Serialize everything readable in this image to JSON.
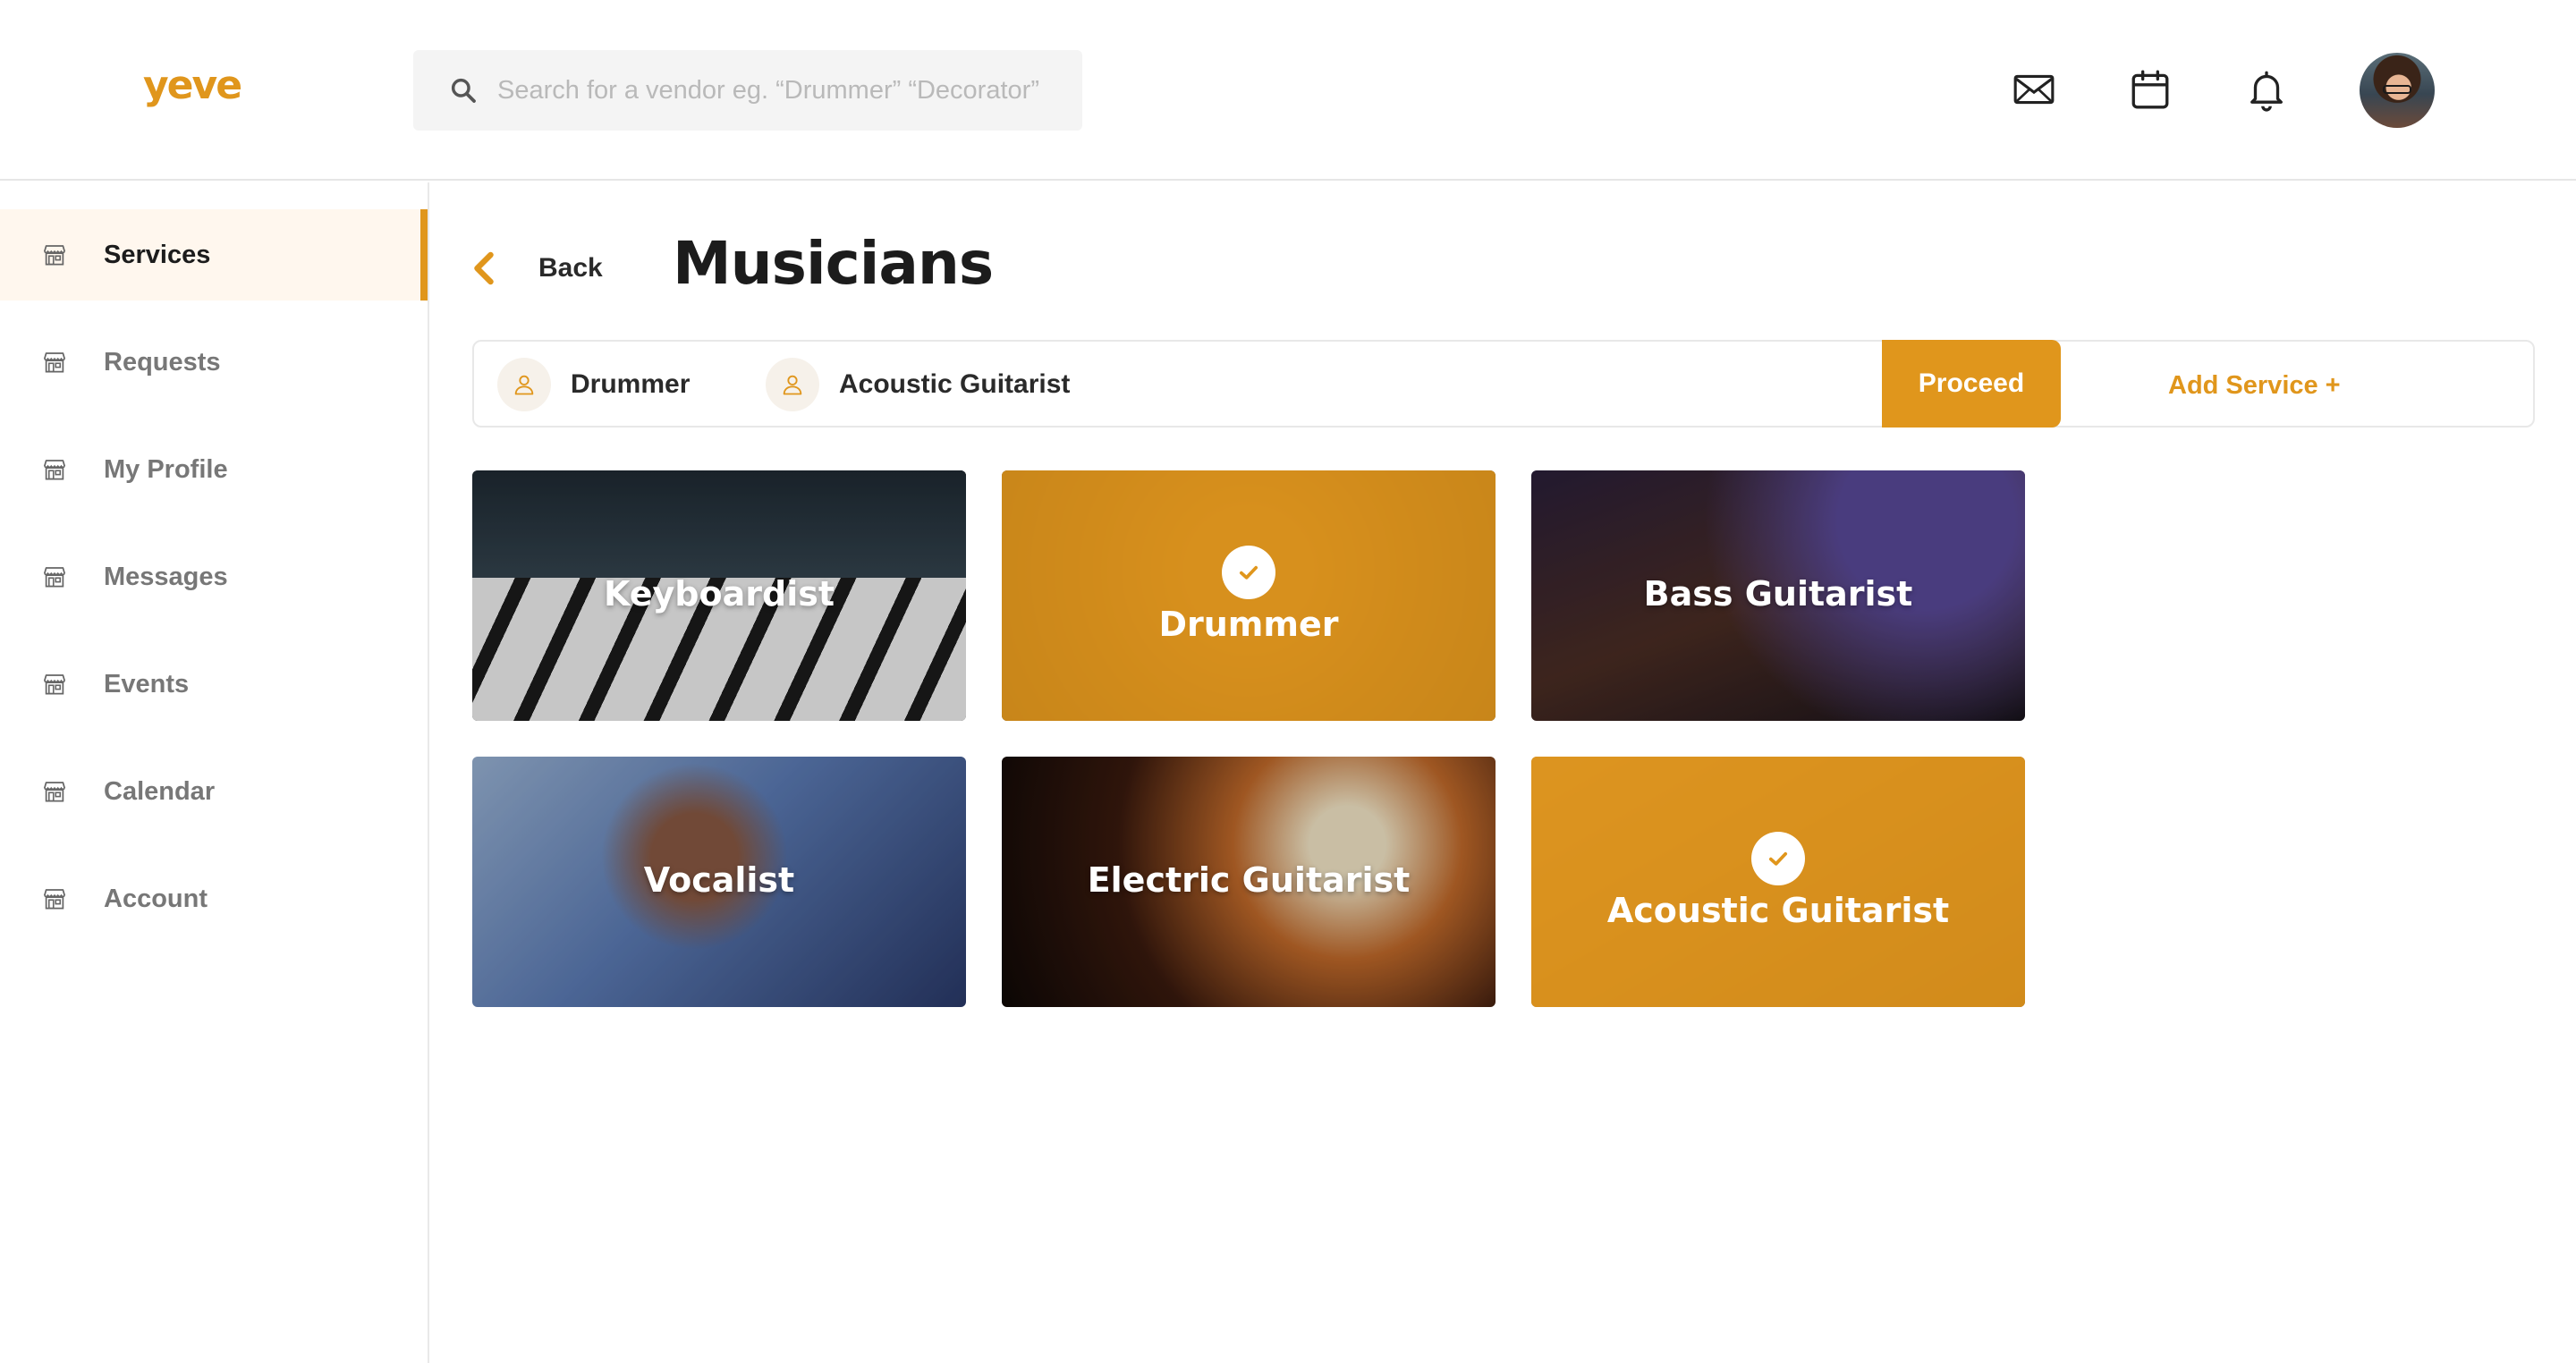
{
  "brand": {
    "logo_text": "yeve",
    "accent_color": "#e0961c"
  },
  "search": {
    "placeholder": "Search for a vendor eg. “Drummer” “Decorator”",
    "icon": "search-icon"
  },
  "header_icons": [
    "mail-icon",
    "calendar-icon",
    "bell-icon"
  ],
  "sidebar": {
    "items": [
      {
        "label": "Services",
        "icon": "store-icon",
        "active": true
      },
      {
        "label": "Requests",
        "icon": "store-icon",
        "active": false
      },
      {
        "label": "My Profile",
        "icon": "store-icon",
        "active": false
      },
      {
        "label": "Messages",
        "icon": "store-icon",
        "active": false
      },
      {
        "label": "Events",
        "icon": "store-icon",
        "active": false
      },
      {
        "label": "Calendar",
        "icon": "store-icon",
        "active": false
      },
      {
        "label": "Account",
        "icon": "store-icon",
        "active": false
      }
    ]
  },
  "main": {
    "back_label": "Back",
    "title": "Musicians",
    "selected_services": [
      {
        "label": "Drummer",
        "icon": "user-icon"
      },
      {
        "label": "Acoustic Guitarist",
        "icon": "user-icon"
      }
    ],
    "add_service_label": "Add Service +",
    "proceed_label": "Proceed",
    "cards": [
      {
        "label": "Keyboardist",
        "selected": false
      },
      {
        "label": "Drummer",
        "selected": true
      },
      {
        "label": "Bass Guitarist",
        "selected": false
      },
      {
        "label": "Vocalist",
        "selected": false
      },
      {
        "label": "Electric Guitarist",
        "selected": false
      },
      {
        "label": "Acoustic Guitarist",
        "selected": true
      }
    ]
  }
}
